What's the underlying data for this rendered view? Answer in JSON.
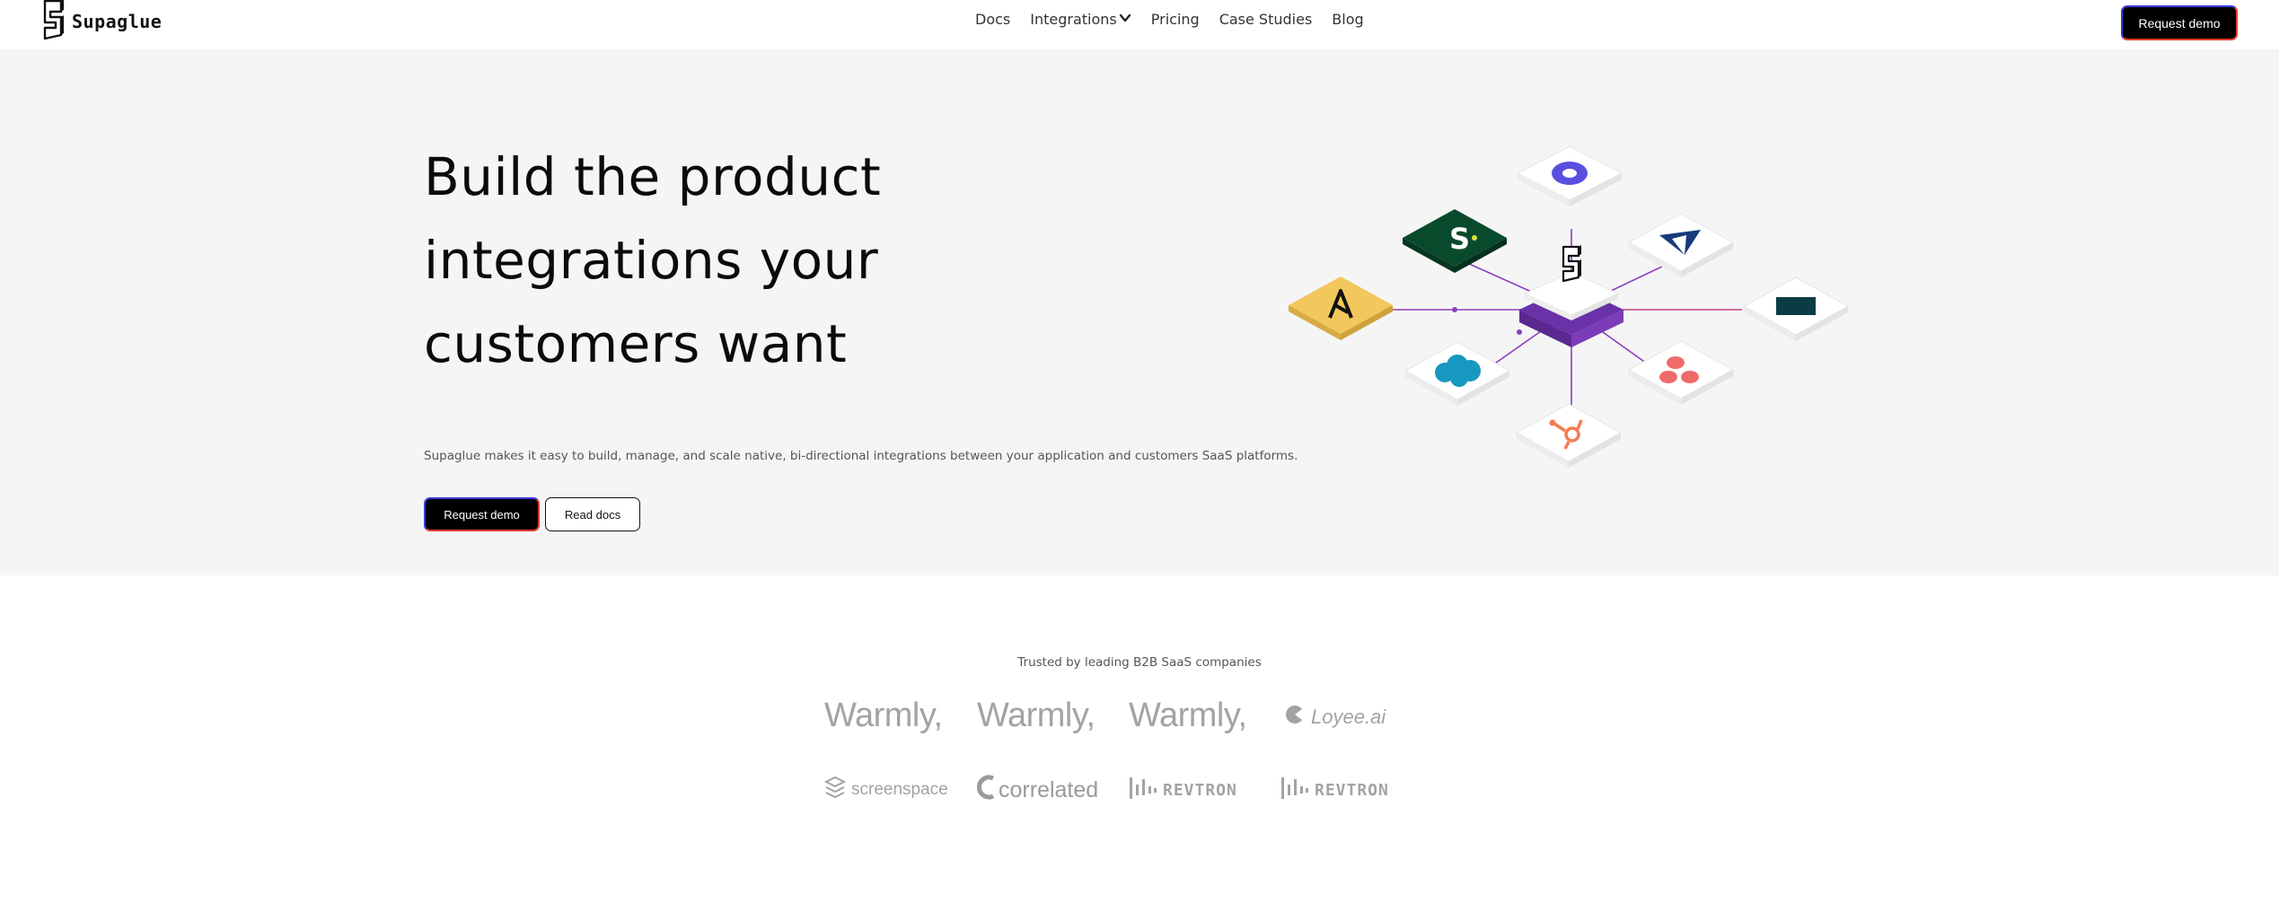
{
  "brand": {
    "name": "Supaglue"
  },
  "nav": {
    "links": [
      {
        "label": "Docs"
      },
      {
        "label": "Integrations"
      },
      {
        "label": "Pricing"
      },
      {
        "label": "Case Studies"
      },
      {
        "label": "Blog"
      }
    ],
    "cta_label": "Request demo"
  },
  "hero": {
    "title_lines": [
      "Build the product",
      "integrations your",
      "customers want"
    ],
    "subtitle": "Supaglue makes it easy to build, manage, and scale native, bi-directional integrations between your application and customers SaaS platforms.",
    "primary_cta": "Request demo",
    "secondary_cta": "Read docs",
    "integration_icons": [
      "okta-icon",
      "salesloft-icon",
      "apollo-icon",
      "outreach-icon",
      "zendesk-icon",
      "salesforce-icon",
      "asana-icon",
      "hubspot-icon"
    ]
  },
  "trusted": {
    "label": "Trusted by leading B2B SaaS companies",
    "logos": [
      "Warmly,",
      "Warmly,",
      "Warmly,",
      "Loyee.ai",
      "screenspace",
      "correlated",
      "REVTRON",
      "REVTRON"
    ]
  },
  "colors": {
    "accent_purple": "#7b3fc1",
    "cta_border_left": "#3b3bd8",
    "cta_border_right": "#e23b2c",
    "hero_bg": "#f5f5f5"
  }
}
